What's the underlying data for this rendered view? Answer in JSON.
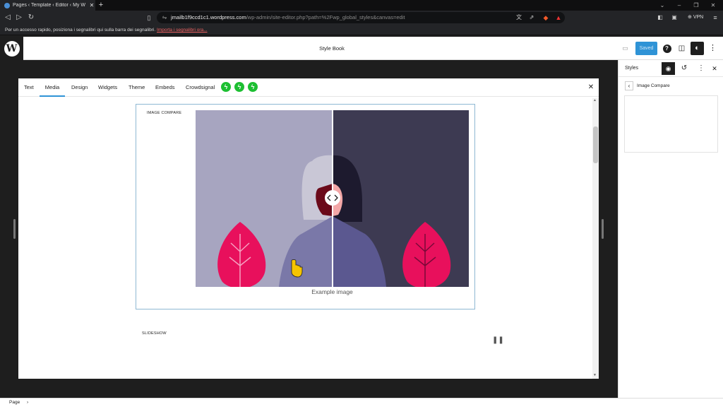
{
  "browser": {
    "tab_title": "Pages ‹ Template ‹ Editor ‹ My W",
    "tab_close": "✕",
    "new_tab": "+",
    "url_host": "jmailb1f9ccd1c1.wordpress.com",
    "url_path": "/wp-admin/site-editor.php?path=%2Fwp_global_styles&canvas=edit",
    "vpn_label": "VPN",
    "bookmarks_text": "Per un accesso rapido, posiziona i segnalibri qui sulla barra dei segnalibri.",
    "bookmarks_link": "Importa i segnalibri ora..."
  },
  "editor": {
    "title": "Style Book",
    "saved_label": "Saved"
  },
  "stylebook": {
    "tabs": [
      "Text",
      "Media",
      "Design",
      "Widgets",
      "Theme",
      "Embeds",
      "Crowdsignal"
    ],
    "active_tab": "Media",
    "jetpack_icons": [
      "jetpack-icon",
      "jetpack-icon",
      "jetpack-icon"
    ],
    "close": "✕",
    "image_compare_label": "IMAGE COMPARE",
    "caption": "Example image",
    "slideshow_label": "SLIDESHOW"
  },
  "sidebar": {
    "title": "Styles",
    "breadcrumb": "Image Compare"
  },
  "footer": {
    "breadcrumb": "Page",
    "chevron": "›"
  },
  "colors": {
    "accent": "#2f93d6",
    "left_bg": "#a7a5c0",
    "right_bg": "#3d3a52",
    "leaf": "#e8105c",
    "jetpack": "#1dbf32"
  }
}
